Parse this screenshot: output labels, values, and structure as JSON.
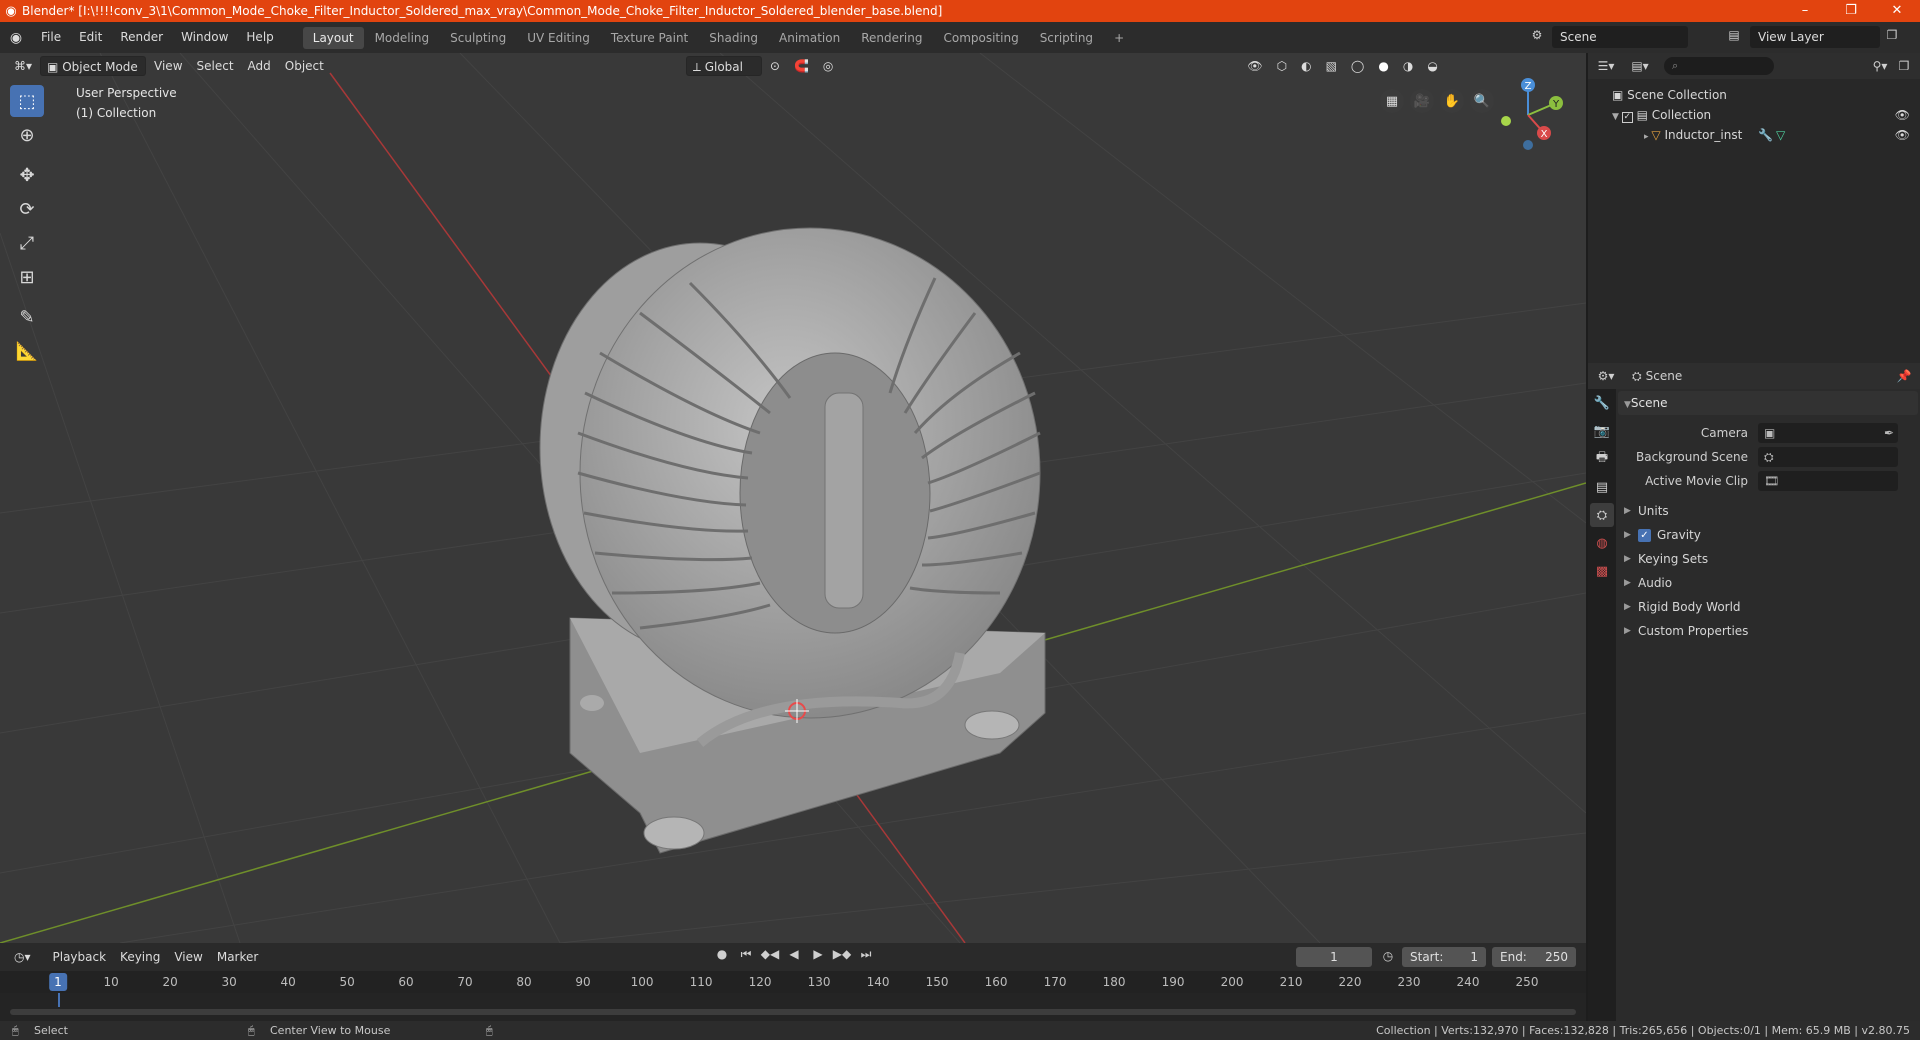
{
  "window": {
    "title": "Blender* [I:\\!!!!conv_3\\1\\Common_Mode_Choke_Filter_Inductor_Soldered_max_vray\\Common_Mode_Choke_Filter_Inductor_Soldered_blender_base.blend]",
    "controls": [
      "–",
      "❐",
      "✕"
    ]
  },
  "menus": [
    "File",
    "Edit",
    "Render",
    "Window",
    "Help"
  ],
  "workspaces": [
    "Layout",
    "Modeling",
    "Sculpting",
    "UV Editing",
    "Texture Paint",
    "Shading",
    "Animation",
    "Rendering",
    "Compositing",
    "Scripting",
    "+"
  ],
  "active_workspace": "Layout",
  "scene_selector": "Scene",
  "view_layer": "View Layer",
  "viewport": {
    "mode": "Object Mode",
    "menus": [
      "View",
      "Select",
      "Add",
      "Object"
    ],
    "transform_orientation": "Global",
    "perspective_label": "User Perspective",
    "collection_label": "(1) Collection",
    "gizmo_axes": [
      "Z",
      "Y",
      "X"
    ]
  },
  "tools": [
    "select-box",
    "cursor",
    "move",
    "rotate",
    "scale",
    "transform",
    "annotate",
    "measure"
  ],
  "outliner": {
    "search_placeholder": "",
    "root": "Scene Collection",
    "collection": "Collection",
    "object": "Inductor_inst"
  },
  "properties": {
    "header": "Scene",
    "panel": "Scene",
    "camera_label": "Camera",
    "background_scene_label": "Background Scene",
    "active_movie_clip_label": "Active Movie Clip",
    "subpanels": [
      "Units",
      "Gravity",
      "Keying Sets",
      "Audio",
      "Rigid Body World",
      "Custom Properties"
    ],
    "gravity_checked": true
  },
  "timeline": {
    "menus": [
      "Playback",
      "Keying",
      "View",
      "Marker"
    ],
    "current_frame": "1",
    "start_label": "Start:",
    "start": "1",
    "end_label": "End:",
    "end": "250",
    "ruler": [
      "10",
      "20",
      "30",
      "40",
      "50",
      "60",
      "70",
      "80",
      "90",
      "100",
      "110",
      "120",
      "130",
      "140",
      "150",
      "160",
      "170",
      "180",
      "190",
      "200",
      "210",
      "220",
      "230",
      "240",
      "250"
    ],
    "ruler_current": "1"
  },
  "status": {
    "left": "Select",
    "middle": "Center View to Mouse",
    "right": "Collection | Verts:132,970 | Faces:132,828 | Tris:265,656 | Objects:0/1 | Mem: 65.9 MB | v2.80.75"
  },
  "colors": {
    "title_bar": "#e2440f",
    "accent": "#4772b3",
    "viewport_bg": "#393939",
    "x_axis": "#d94a4a",
    "y_axis": "#8cbf3f",
    "z_axis": "#4a8fd9"
  }
}
